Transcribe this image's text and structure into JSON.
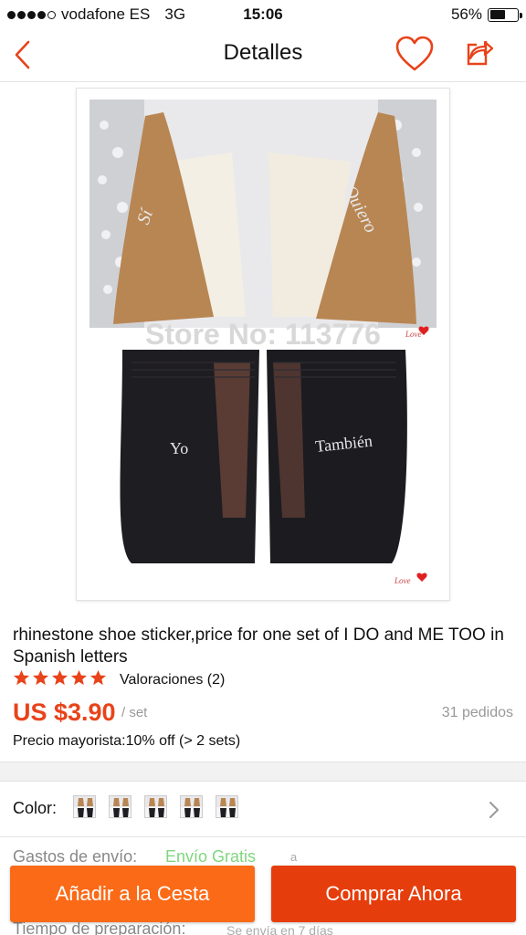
{
  "status_bar": {
    "carrier": "vodafone ES",
    "network": "3G",
    "time": "15:06",
    "battery": "56%",
    "battery_level": 0.56,
    "signal_bars": 4
  },
  "nav": {
    "title": "Detalles",
    "back_icon": "chevron-left-icon",
    "favorite_icon": "heart-icon",
    "share_icon": "share-icon"
  },
  "product": {
    "image_watermark": "Store No: 113776",
    "sole_texts": [
      "Sí",
      "Quiero",
      "Yo",
      "También"
    ],
    "badge": "Love",
    "title": " rhinestone  shoe sticker,price for one set of I DO and ME TOO in Spanish letters",
    "rating": 5,
    "reviews_label": "Valoraciones (2)",
    "price": "US $3.90",
    "unit": "/ set",
    "orders": "31 pedidos",
    "wholesale": "Precio mayorista:10% off (> 2 sets)"
  },
  "options": {
    "color_label": "Color:",
    "swatch_count": 5,
    "shipping_label": "Gastos de envío:",
    "shipping_value": "Envío Gratis",
    "shipping_extra": "a",
    "prep_label": "Tiempo de preparación:",
    "prep_value": "Se envía en 7 días"
  },
  "actions": {
    "add_to_cart": "Añadir a la Cesta",
    "buy_now": "Comprar Ahora"
  },
  "colors": {
    "accent": "#e8431a",
    "cart_button": "#fb6a17",
    "buy_button": "#e63d0c",
    "free_shipping": "#7fd67f"
  }
}
